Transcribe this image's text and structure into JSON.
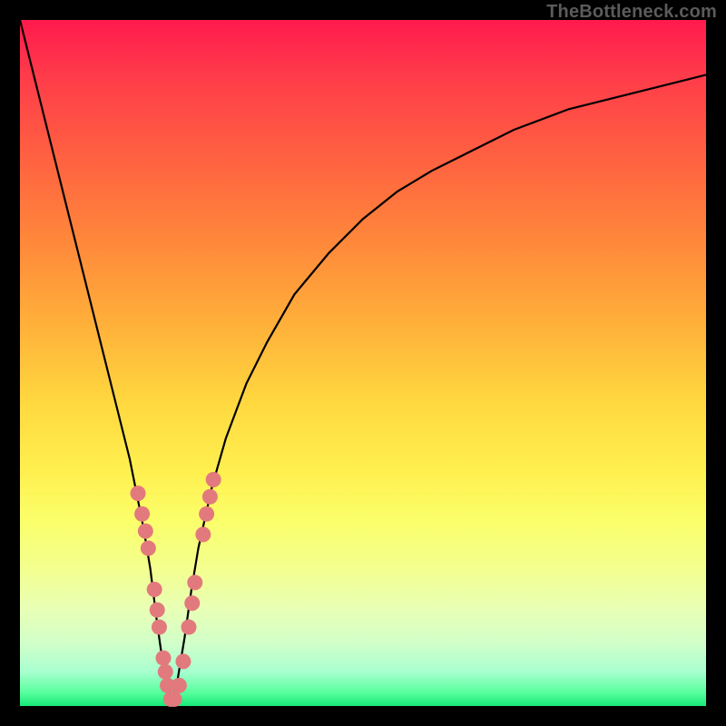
{
  "watermark": "TheBottleneck.com",
  "colors": {
    "frame": "#000000",
    "curve_stroke": "#000000",
    "marker_fill": "#e27a7d",
    "gradient_top": "#ff1a4d",
    "gradient_bottom": "#17e878"
  },
  "chart_data": {
    "type": "line",
    "title": "",
    "xlabel": "",
    "ylabel": "",
    "xlim": [
      0,
      100
    ],
    "ylim": [
      0,
      100
    ],
    "x_optimum": 22,
    "annotations": [],
    "series": [
      {
        "name": "bottleneck-curve",
        "x": [
          0,
          2,
          4,
          6,
          8,
          10,
          12,
          14,
          16,
          18,
          19,
          20,
          21,
          22,
          23,
          24,
          25,
          26,
          28,
          30,
          33,
          36,
          40,
          45,
          50,
          55,
          60,
          66,
          72,
          80,
          88,
          96,
          100
        ],
        "y": [
          100,
          92,
          84,
          76,
          68,
          60,
          52,
          44,
          36,
          26,
          20,
          12,
          5,
          0,
          4,
          10,
          17,
          23,
          32,
          39,
          47,
          53,
          60,
          66,
          71,
          75,
          78,
          81,
          84,
          87,
          89,
          91,
          92
        ]
      }
    ],
    "markers": {
      "name": "data-points",
      "points": [
        {
          "x": 17.2,
          "y": 31
        },
        {
          "x": 17.8,
          "y": 28
        },
        {
          "x": 18.3,
          "y": 25.5
        },
        {
          "x": 18.7,
          "y": 23
        },
        {
          "x": 19.6,
          "y": 17
        },
        {
          "x": 20.0,
          "y": 14
        },
        {
          "x": 20.3,
          "y": 11.5
        },
        {
          "x": 20.9,
          "y": 7
        },
        {
          "x": 21.2,
          "y": 5
        },
        {
          "x": 21.5,
          "y": 3
        },
        {
          "x": 22.0,
          "y": 1
        },
        {
          "x": 22.5,
          "y": 1
        },
        {
          "x": 23.2,
          "y": 3
        },
        {
          "x": 23.8,
          "y": 6.5
        },
        {
          "x": 24.6,
          "y": 11.5
        },
        {
          "x": 25.1,
          "y": 15
        },
        {
          "x": 25.5,
          "y": 18
        },
        {
          "x": 26.7,
          "y": 25
        },
        {
          "x": 27.2,
          "y": 28
        },
        {
          "x": 27.7,
          "y": 30.5
        },
        {
          "x": 28.2,
          "y": 33
        }
      ]
    }
  }
}
